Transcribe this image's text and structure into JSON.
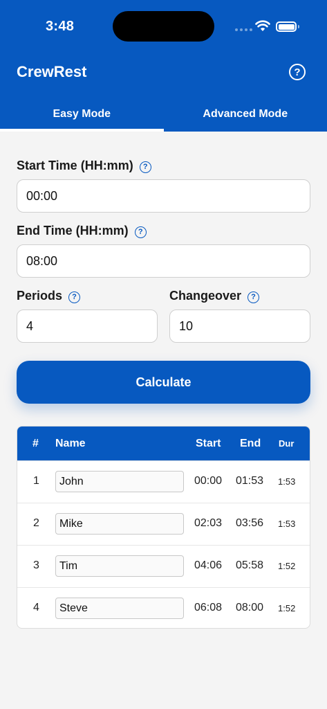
{
  "status_bar": {
    "time": "3:48"
  },
  "header": {
    "title": "CrewRest",
    "help_icon": "?"
  },
  "tabs": [
    {
      "label": "Easy Mode",
      "active": true
    },
    {
      "label": "Advanced Mode",
      "active": false
    }
  ],
  "form": {
    "start_time": {
      "label": "Start Time (HH:mm)",
      "value": "00:00"
    },
    "end_time": {
      "label": "End Time (HH:mm)",
      "value": "08:00"
    },
    "periods": {
      "label": "Periods",
      "value": "4"
    },
    "changeover": {
      "label": "Changeover",
      "value": "10"
    },
    "help_icon": "?"
  },
  "calculate_label": "Calculate",
  "table": {
    "headers": {
      "num": "#",
      "name": "Name",
      "start": "Start",
      "end": "End",
      "dur": "Dur"
    },
    "rows": [
      {
        "num": "1",
        "name": "John",
        "start": "00:00",
        "end": "01:53",
        "dur": "1:53"
      },
      {
        "num": "2",
        "name": "Mike",
        "start": "02:03",
        "end": "03:56",
        "dur": "1:53"
      },
      {
        "num": "3",
        "name": "Tim",
        "start": "04:06",
        "end": "05:58",
        "dur": "1:52"
      },
      {
        "num": "4",
        "name": "Steve",
        "start": "06:08",
        "end": "08:00",
        "dur": "1:52"
      }
    ]
  },
  "colors": {
    "primary": "#0759c0",
    "background": "#f4f4f4"
  }
}
